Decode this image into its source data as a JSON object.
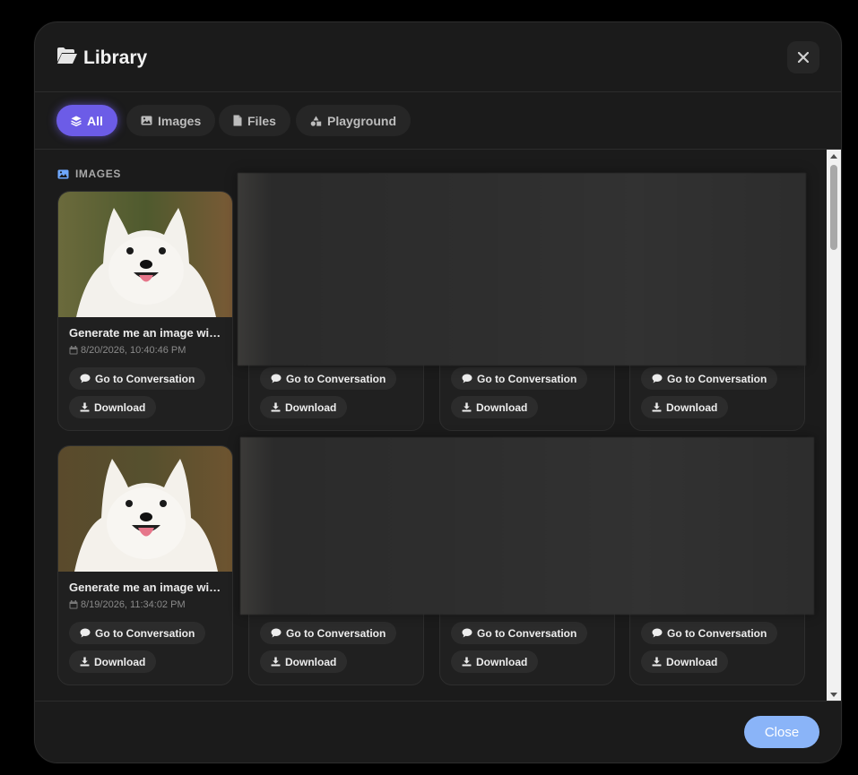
{
  "header": {
    "title": "Library"
  },
  "filters": [
    {
      "label": "All",
      "icon": "layers-icon",
      "active": true
    },
    {
      "label": "Images",
      "icon": "image-icon",
      "active": false
    },
    {
      "label": "Files",
      "icon": "file-icon",
      "active": false
    },
    {
      "label": "Playground",
      "icon": "shapes-icon",
      "active": false
    }
  ],
  "section": {
    "label": "IMAGES"
  },
  "cards": [
    {
      "title": "Generate me an image with…",
      "date": "8/20/2026, 10:40:46 PM",
      "go_label": "Go to Conversation",
      "download_label": "Download"
    },
    {
      "go_label": "Go to Conversation",
      "download_label": "Download"
    },
    {
      "go_label": "Go to Conversation",
      "download_label": "Download"
    },
    {
      "go_label": "Go to Conversation",
      "download_label": "Download"
    },
    {
      "title": "Generate me an image with…",
      "date": "8/19/2026, 11:34:02 PM",
      "go_label": "Go to Conversation",
      "download_label": "Download"
    },
    {
      "go_label": "Go to Conversation",
      "download_label": "Download"
    },
    {
      "go_label": "Go to Conversation",
      "download_label": "Download"
    },
    {
      "go_label": "Go to Conversation",
      "download_label": "Download"
    }
  ],
  "footer": {
    "close_label": "Close"
  },
  "colors": {
    "accent": "#6c5ce7",
    "close_button": "#8ab4f8",
    "background": "#1b1b1b"
  }
}
